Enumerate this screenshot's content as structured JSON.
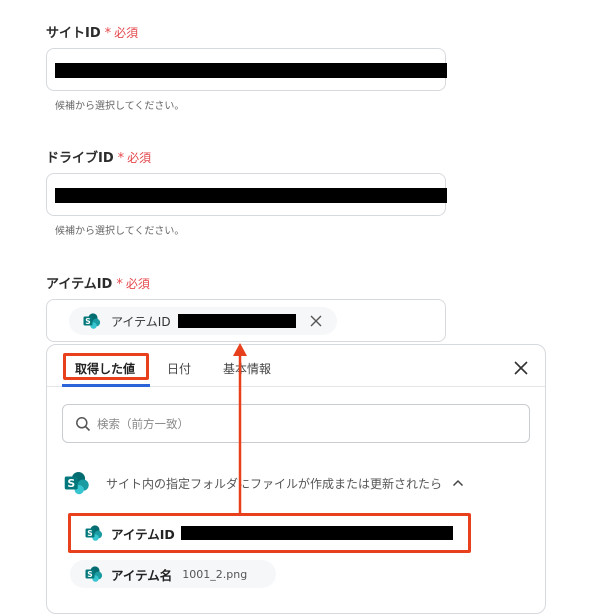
{
  "form": {
    "required_label": "必須",
    "required_mark": "*",
    "site_id": {
      "label": "サイトID",
      "hint": "候補から選択してください。"
    },
    "drive_id": {
      "label": "ドライブID",
      "hint": "候補から選択してください。"
    },
    "item_id": {
      "label": "アイテムID",
      "chip_label": "アイテムID"
    }
  },
  "picker": {
    "tabs": [
      "取得した値",
      "日付",
      "基本情報"
    ],
    "active_tab": "取得した値",
    "search_placeholder": "検索（前方一致）",
    "group": {
      "label": "サイト内の指定フォルダにファイルが作成または更新されたら",
      "items": [
        {
          "label": "アイテムID",
          "value": ""
        },
        {
          "label": "アイテム名",
          "value": "1001_2.png"
        }
      ]
    }
  },
  "colors": {
    "required": "#e5484d",
    "highlight": "#e8401c",
    "sharepoint": "#038387"
  },
  "icons": {
    "chip": "sharepoint-icon",
    "clear": "close-icon",
    "panel_close": "close-icon",
    "search": "search-icon",
    "collapse": "chevron-up-icon"
  }
}
